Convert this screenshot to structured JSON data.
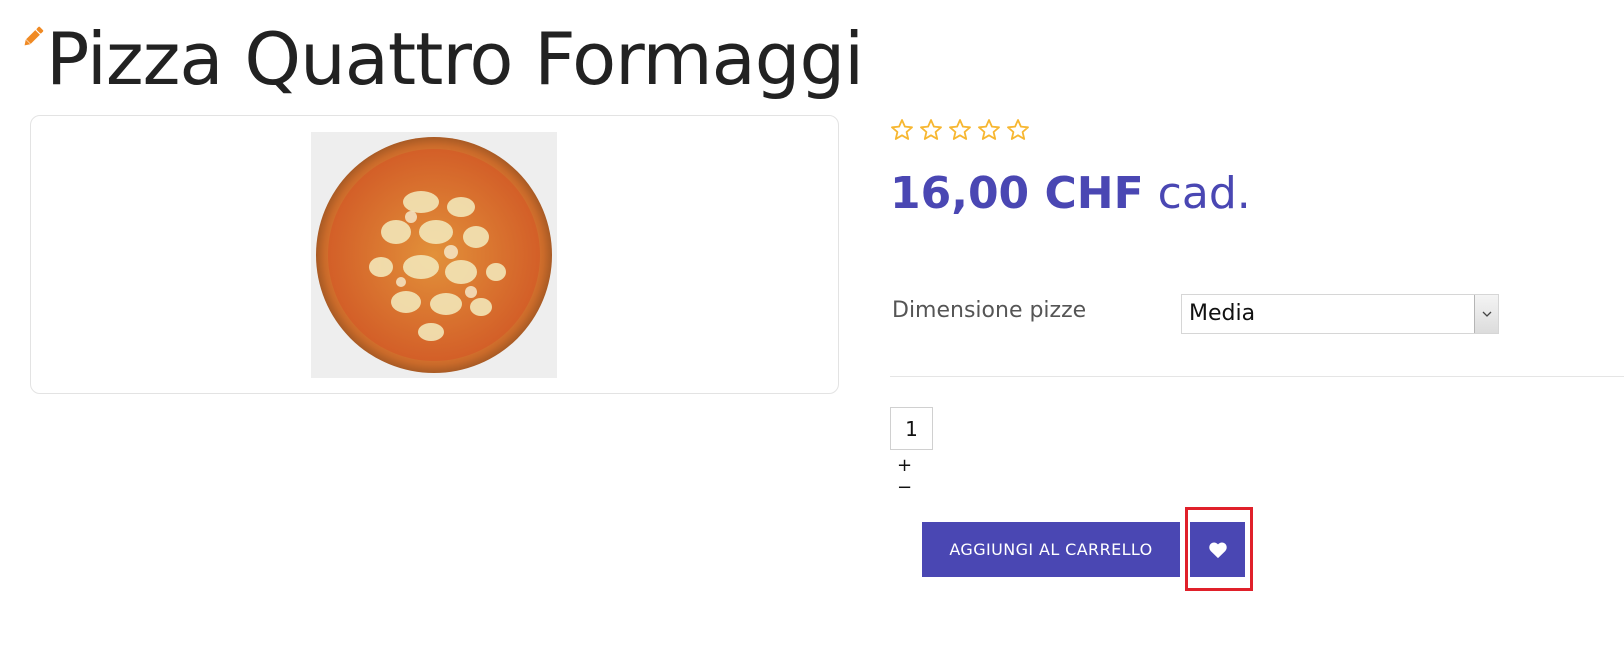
{
  "product": {
    "title": "Pizza Quattro Formaggi",
    "rating": {
      "value": 0,
      "max": 5
    },
    "price": {
      "amount": "16,00 CHF",
      "unit": "cad."
    }
  },
  "options": {
    "size_label": "Dimensione pizze",
    "size_selected": "Media"
  },
  "quantity": {
    "value": "1",
    "increment": "+",
    "decrement": "−"
  },
  "actions": {
    "add_to_cart": "AGGIUNGI AL CARRELLO",
    "wishlist_icon": "heart-icon"
  },
  "icons": {
    "edit": "pencil-icon",
    "star": "star-outline-icon",
    "dropdown": "chevron-down-icon"
  },
  "colors": {
    "accent": "#4a47b3",
    "star": "#f7b731",
    "edit_icon": "#f08a24",
    "highlight": "#e0202a"
  }
}
